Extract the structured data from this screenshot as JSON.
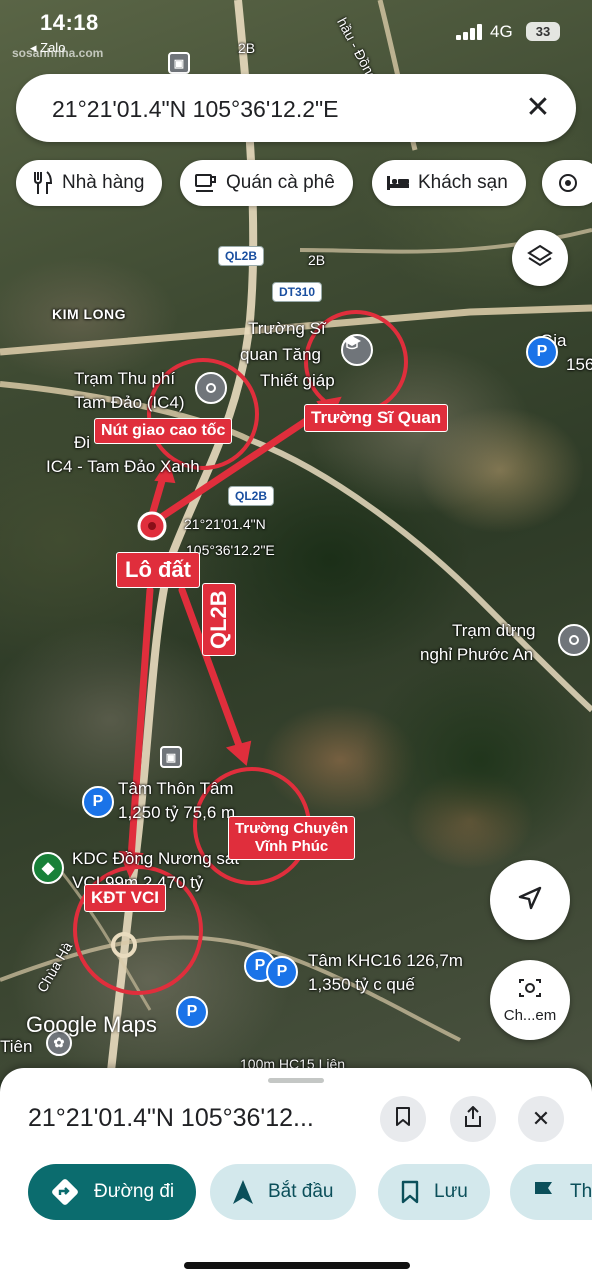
{
  "status_bar": {
    "time": "14:18",
    "back_app": "◂ Zalo",
    "watermark": "sosanhnha.com",
    "network": "4G",
    "battery": "33"
  },
  "search": {
    "query": "21°21'01.4\"N 105°36'12.2\"E",
    "close_icon": "close-icon"
  },
  "chips": [
    {
      "label": "Nhà hàng",
      "icon": "restaurant-icon"
    },
    {
      "label": "Quán cà phê",
      "icon": "coffee-icon"
    },
    {
      "label": "Khách sạn",
      "icon": "hotel-icon"
    }
  ],
  "map": {
    "road_shields": {
      "ql2b_top": "QL2B",
      "dt310": "DT310",
      "ql2b_mid": "QL2B",
      "road_2b_a": "2B",
      "road_2b_b": "2B"
    },
    "labels": {
      "kim_long": "KIM LONG",
      "truong_si_l1": "Trường Sĩ",
      "truong_si_l2": "quan Tăng",
      "truong_si_l3": "Thiết giáp",
      "tram_thu_phi_l1": "Trạm Thu phí",
      "tram_thu_phi_l2": "Tam Đảo (IC4)",
      "ic4_l1": "Đi",
      "ic4_l2": "IC4 - Tam Đảo Xanh",
      "coord_l1": "21°21'01.4\"N",
      "coord_l2": "105°36'12.2\"E",
      "tram_dung_l1": "Trạm dừng",
      "tram_dung_l2": "nghỉ Phước An",
      "tam_thon_l1": "Tâm Thôn Tâm",
      "tam_thon_l2": "1,250 tỷ 75,6 m",
      "kdc_l1": "KDC Đồng Nương sát",
      "kdc_l2": "VCI 99m 2,470 tỷ",
      "khc16_l1": "Tâm KHC16 126,7m",
      "khc16_l2": "1,350 tỷ c quế",
      "hc15": "100m HC15 Liên",
      "chua_ha": "Chùa Hà",
      "tien": "Tiên",
      "gia_l1": "Gia",
      "gia_l2": "156",
      "top_road": "hầu - Đồng T"
    },
    "annotations": {
      "nut_giao": "Nút giao cao tốc",
      "truong_si_quan": "Trường Sĩ Quan",
      "lo_dat": "Lô đất",
      "ql2b": "QL2B",
      "truong_chuyen_l1": "Trường Chuyên",
      "truong_chuyen_l2": "Vĩnh Phúc",
      "kdt_vci": "KĐT VCI",
      "annotation_color": "#e02e3c"
    },
    "attribution": "Google Maps",
    "layers_icon": "layers-icon",
    "navigate_icon": "navigation-arrow-icon",
    "camera_label": "Ch...em"
  },
  "sheet": {
    "title": "21°21'01.4\"N 105°36'12...",
    "buttons": [
      "bookmark-icon",
      "share-icon",
      "close-icon"
    ],
    "actions": [
      {
        "label": "Đường đi",
        "icon": "directions-icon"
      },
      {
        "label": "Bắt đầu",
        "icon": "navigation-icon"
      },
      {
        "label": "Lưu",
        "icon": "bookmark-icon"
      },
      {
        "label": "Th",
        "icon": "flag-icon"
      }
    ],
    "accent": "#0b6c6e"
  }
}
